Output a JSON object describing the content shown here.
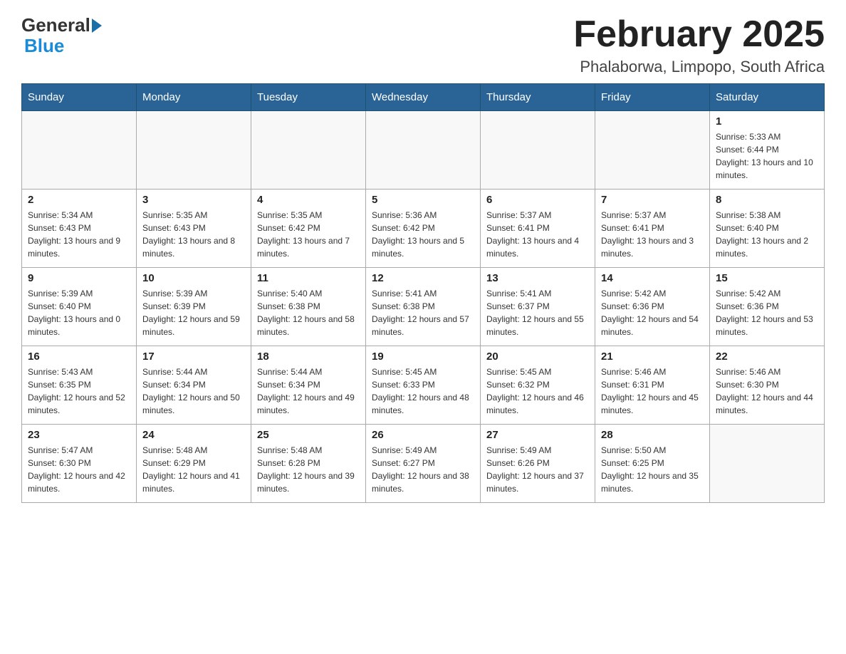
{
  "header": {
    "logo_general": "General",
    "logo_blue": "Blue",
    "title": "February 2025",
    "subtitle": "Phalaborwa, Limpopo, South Africa"
  },
  "weekdays": [
    "Sunday",
    "Monday",
    "Tuesday",
    "Wednesday",
    "Thursday",
    "Friday",
    "Saturday"
  ],
  "weeks": [
    [
      {
        "day": "",
        "info": ""
      },
      {
        "day": "",
        "info": ""
      },
      {
        "day": "",
        "info": ""
      },
      {
        "day": "",
        "info": ""
      },
      {
        "day": "",
        "info": ""
      },
      {
        "day": "",
        "info": ""
      },
      {
        "day": "1",
        "info": "Sunrise: 5:33 AM\nSunset: 6:44 PM\nDaylight: 13 hours and 10 minutes."
      }
    ],
    [
      {
        "day": "2",
        "info": "Sunrise: 5:34 AM\nSunset: 6:43 PM\nDaylight: 13 hours and 9 minutes."
      },
      {
        "day": "3",
        "info": "Sunrise: 5:35 AM\nSunset: 6:43 PM\nDaylight: 13 hours and 8 minutes."
      },
      {
        "day": "4",
        "info": "Sunrise: 5:35 AM\nSunset: 6:42 PM\nDaylight: 13 hours and 7 minutes."
      },
      {
        "day": "5",
        "info": "Sunrise: 5:36 AM\nSunset: 6:42 PM\nDaylight: 13 hours and 5 minutes."
      },
      {
        "day": "6",
        "info": "Sunrise: 5:37 AM\nSunset: 6:41 PM\nDaylight: 13 hours and 4 minutes."
      },
      {
        "day": "7",
        "info": "Sunrise: 5:37 AM\nSunset: 6:41 PM\nDaylight: 13 hours and 3 minutes."
      },
      {
        "day": "8",
        "info": "Sunrise: 5:38 AM\nSunset: 6:40 PM\nDaylight: 13 hours and 2 minutes."
      }
    ],
    [
      {
        "day": "9",
        "info": "Sunrise: 5:39 AM\nSunset: 6:40 PM\nDaylight: 13 hours and 0 minutes."
      },
      {
        "day": "10",
        "info": "Sunrise: 5:39 AM\nSunset: 6:39 PM\nDaylight: 12 hours and 59 minutes."
      },
      {
        "day": "11",
        "info": "Sunrise: 5:40 AM\nSunset: 6:38 PM\nDaylight: 12 hours and 58 minutes."
      },
      {
        "day": "12",
        "info": "Sunrise: 5:41 AM\nSunset: 6:38 PM\nDaylight: 12 hours and 57 minutes."
      },
      {
        "day": "13",
        "info": "Sunrise: 5:41 AM\nSunset: 6:37 PM\nDaylight: 12 hours and 55 minutes."
      },
      {
        "day": "14",
        "info": "Sunrise: 5:42 AM\nSunset: 6:36 PM\nDaylight: 12 hours and 54 minutes."
      },
      {
        "day": "15",
        "info": "Sunrise: 5:42 AM\nSunset: 6:36 PM\nDaylight: 12 hours and 53 minutes."
      }
    ],
    [
      {
        "day": "16",
        "info": "Sunrise: 5:43 AM\nSunset: 6:35 PM\nDaylight: 12 hours and 52 minutes."
      },
      {
        "day": "17",
        "info": "Sunrise: 5:44 AM\nSunset: 6:34 PM\nDaylight: 12 hours and 50 minutes."
      },
      {
        "day": "18",
        "info": "Sunrise: 5:44 AM\nSunset: 6:34 PM\nDaylight: 12 hours and 49 minutes."
      },
      {
        "day": "19",
        "info": "Sunrise: 5:45 AM\nSunset: 6:33 PM\nDaylight: 12 hours and 48 minutes."
      },
      {
        "day": "20",
        "info": "Sunrise: 5:45 AM\nSunset: 6:32 PM\nDaylight: 12 hours and 46 minutes."
      },
      {
        "day": "21",
        "info": "Sunrise: 5:46 AM\nSunset: 6:31 PM\nDaylight: 12 hours and 45 minutes."
      },
      {
        "day": "22",
        "info": "Sunrise: 5:46 AM\nSunset: 6:30 PM\nDaylight: 12 hours and 44 minutes."
      }
    ],
    [
      {
        "day": "23",
        "info": "Sunrise: 5:47 AM\nSunset: 6:30 PM\nDaylight: 12 hours and 42 minutes."
      },
      {
        "day": "24",
        "info": "Sunrise: 5:48 AM\nSunset: 6:29 PM\nDaylight: 12 hours and 41 minutes."
      },
      {
        "day": "25",
        "info": "Sunrise: 5:48 AM\nSunset: 6:28 PM\nDaylight: 12 hours and 39 minutes."
      },
      {
        "day": "26",
        "info": "Sunrise: 5:49 AM\nSunset: 6:27 PM\nDaylight: 12 hours and 38 minutes."
      },
      {
        "day": "27",
        "info": "Sunrise: 5:49 AM\nSunset: 6:26 PM\nDaylight: 12 hours and 37 minutes."
      },
      {
        "day": "28",
        "info": "Sunrise: 5:50 AM\nSunset: 6:25 PM\nDaylight: 12 hours and 35 minutes."
      },
      {
        "day": "",
        "info": ""
      }
    ]
  ]
}
